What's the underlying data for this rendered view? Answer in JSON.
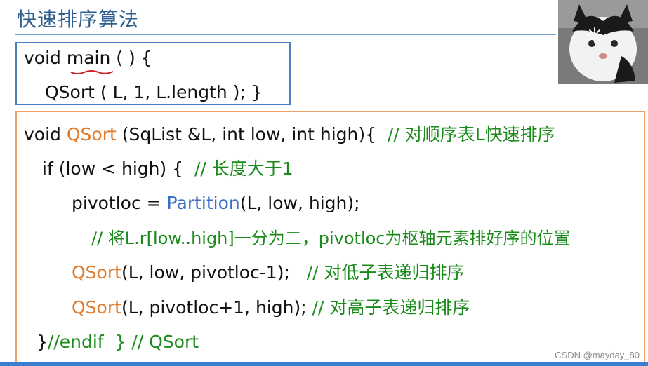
{
  "slide": {
    "title": "快速排序算法"
  },
  "main_box": {
    "line1": "void main ( ) {",
    "line2": "QSort ( L, 1, L.length ); }"
  },
  "qsort_box": {
    "l1_a": "void ",
    "l1_b": "QSort",
    "l1_c": " (SqList &L, int low, int high){  ",
    "l1_comment": "// 对顺序表L快速排序",
    "l2_a": "if (low < high) {  ",
    "l2_comment": "// 长度大于1",
    "l3_a": "pivotloc = ",
    "l3_b": "Partition",
    "l3_c": "(L, low, high);",
    "l4_comment": "// 将L.r[low..high]一分为二，pivotloc为枢轴元素排好序的位置",
    "l5_b": "QSort",
    "l5_c": "(L, low, pivotloc-1);   ",
    "l5_comment": "// 对低子表递归排序",
    "l6_b": "QSort",
    "l6_c": "(L, pivotloc+1, high); ",
    "l6_comment": "// 对高子表递归排序",
    "l7_a": "}",
    "l7_comment": "//endif  } // QSort"
  },
  "watermark": "CSDN @mayday_80",
  "colors": {
    "title": "#2e5e8c",
    "keyword_orange": "#e07a2a",
    "keyword_blue": "#3a6fc4",
    "comment": "#1a8a1a",
    "main_border": "#4a7fc1",
    "qsort_border": "#f0a060"
  }
}
